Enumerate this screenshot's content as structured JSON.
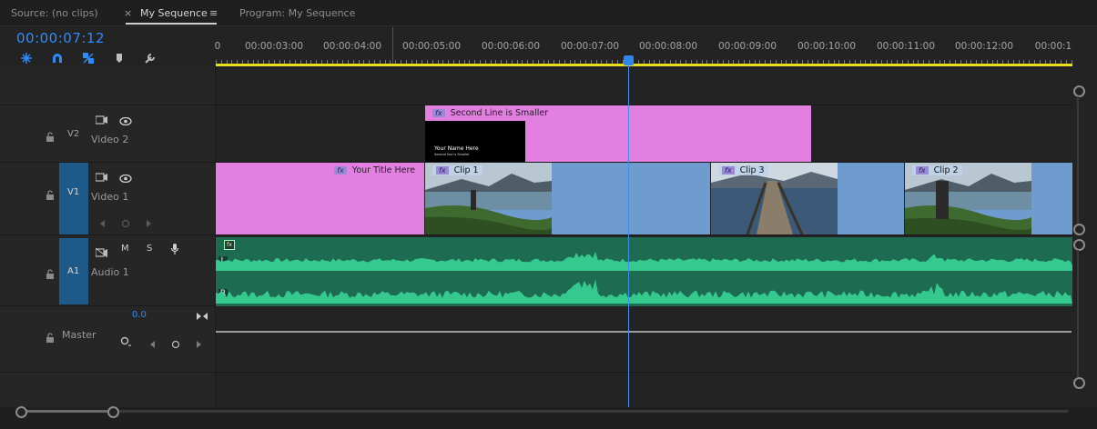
{
  "tabs": {
    "source": "Source: (no clips)",
    "close": "×",
    "sequence": "My Sequence",
    "menu": "≡",
    "program": "Program: My Sequence"
  },
  "timecode": "00:00:07:12",
  "tools": [
    "snap-icon",
    "magnet-icon",
    "linked-selection-icon",
    "marker-icon",
    "wrench-icon"
  ],
  "ruler": {
    "labels": [
      "0",
      "00:00:03:00",
      "00:00:04:00",
      "00:00:05:00",
      "00:00:06:00",
      "00:00:07:00",
      "00:00:08:00",
      "00:00:09:00",
      "00:00:10:00",
      "00:00:11:00",
      "00:00:12:00",
      "00:00:1"
    ]
  },
  "tracks": {
    "v2": {
      "id": "V2",
      "name": "Video 2"
    },
    "v1": {
      "id": "V1",
      "name": "Video 1"
    },
    "a1": {
      "id": "A1",
      "name": "Audio 1",
      "mute": "M",
      "solo": "S"
    },
    "master": {
      "name": "Master",
      "volume": "0.0"
    }
  },
  "clips": {
    "v2_title": "Second Line is Smaller",
    "v2_thumb_line1": "Your Name Here",
    "v2_thumb_line2": "Second line is Smaller",
    "v1_title": "Your Title Here",
    "clip1": "Clip 1",
    "clip3": "Clip 3",
    "clip2": "Clip 2",
    "fx": "fx"
  },
  "audio": {
    "left": "L",
    "right": "R"
  },
  "colors": {
    "accent": "#2e8bff",
    "title_clip": "#e27fe0",
    "video_clip": "#6f9ccf",
    "audio_clip": "#1d6b50",
    "waveform": "#36c98f",
    "work_area": "#e6e020"
  }
}
